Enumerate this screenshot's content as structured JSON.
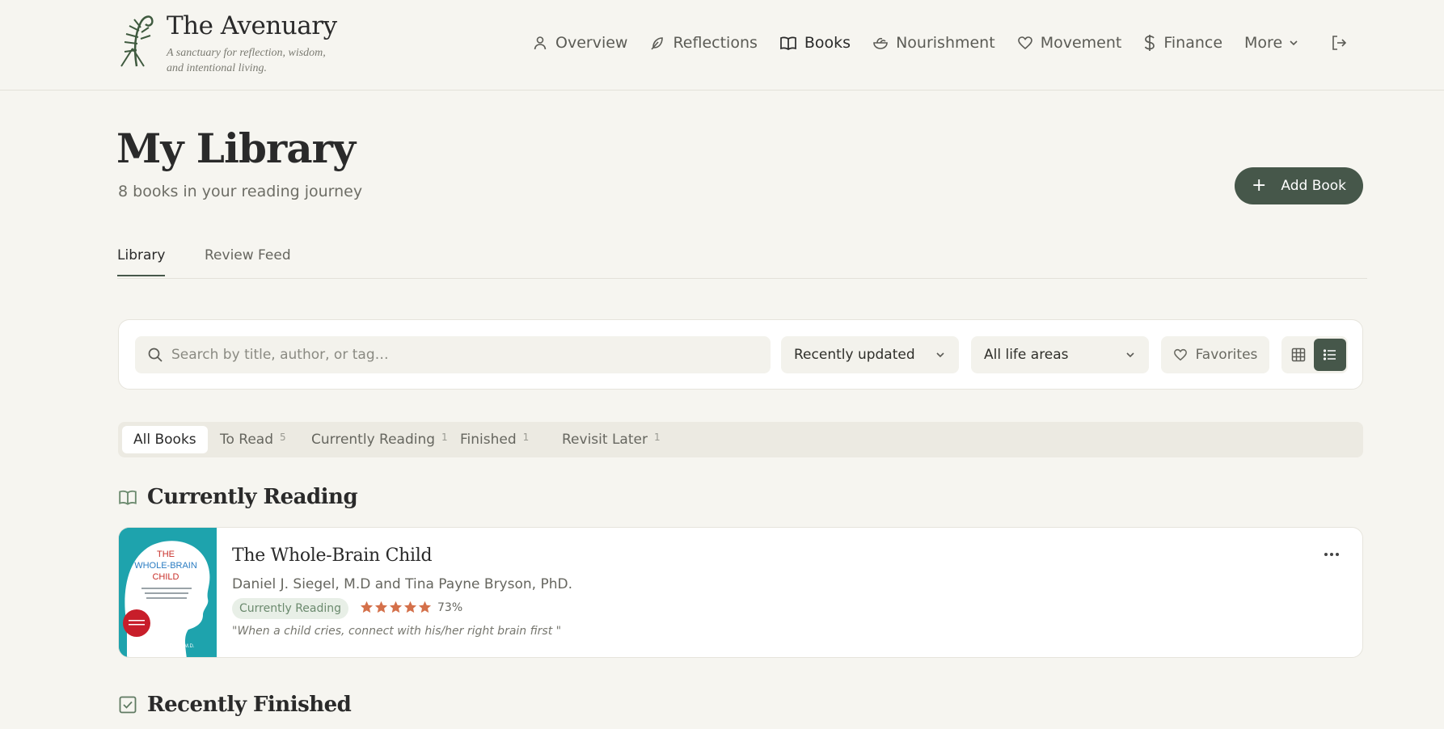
{
  "brand": {
    "title": "The Avenuary",
    "tagline": "A sanctuary for reflection, wisdom, and intentional living."
  },
  "nav": {
    "items": [
      {
        "label": "Overview",
        "icon": "user-icon"
      },
      {
        "label": "Reflections",
        "icon": "feather-icon"
      },
      {
        "label": "Books",
        "icon": "book-open-icon"
      },
      {
        "label": "Nourishment",
        "icon": "salad-icon"
      },
      {
        "label": "Movement",
        "icon": "heart-icon"
      },
      {
        "label": "Finance",
        "icon": "dollar-icon"
      },
      {
        "label": "More",
        "icon": "chevron-down-icon"
      }
    ],
    "active": "Books",
    "logout_icon": "logout-icon"
  },
  "page": {
    "title": "My Library",
    "subtitle": "8 books in your reading journey",
    "add_button": "Add Book"
  },
  "tabs": [
    {
      "label": "Library"
    },
    {
      "label": "Review Feed"
    }
  ],
  "filters": {
    "search_placeholder": "Search by title, author, or tag…",
    "sort_value": "Recently updated",
    "area_value": "All life areas",
    "favorites_label": "Favorites"
  },
  "chips": [
    {
      "label": "All Books",
      "count": ""
    },
    {
      "label": "To Read",
      "count": "5"
    },
    {
      "label": "Currently Reading",
      "count": "1"
    },
    {
      "label": "Finished",
      "count": "1"
    },
    {
      "label": "Revisit Later",
      "count": "1"
    }
  ],
  "sections": {
    "current": "Currently Reading",
    "finished": "Recently Finished"
  },
  "book": {
    "title": "The Whole-Brain Child",
    "author": "Daniel J. Siegel, M.D and Tina Payne Bryson, PhD.",
    "status": "Currently Reading",
    "rating": 5,
    "progress": "73%",
    "quote": "\"When a child cries, connect with his/her right brain first \"",
    "cover": {
      "line1": "THE",
      "line2": "WHOLE-BRAIN",
      "line3": "CHILD",
      "authors": "DANIEL J. SIEGEL, M.D."
    }
  },
  "colors": {
    "accent": "#46574a",
    "background": "#f6f5f0",
    "star": "#d4704a",
    "cover": "#1ea3ad"
  }
}
